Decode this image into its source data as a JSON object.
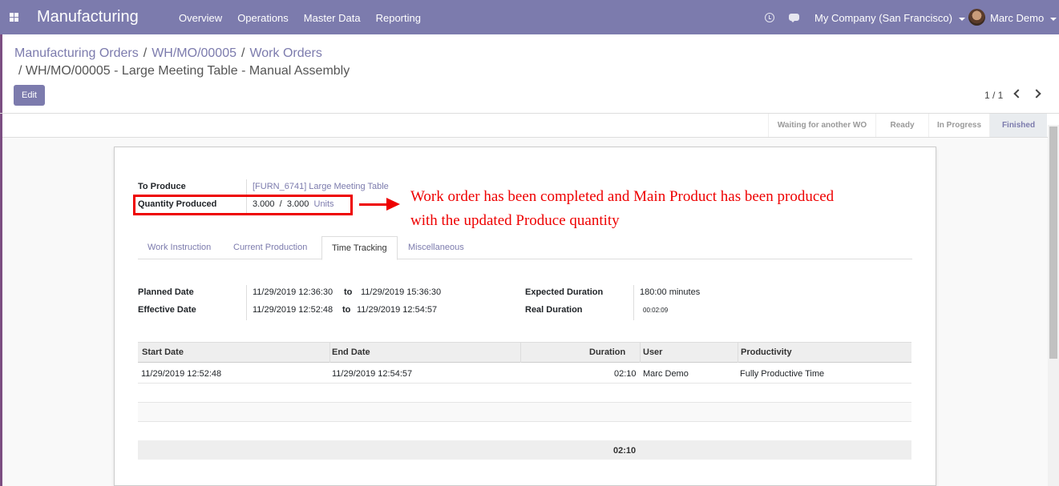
{
  "topbar": {
    "app_title": "Manufacturing",
    "menu": [
      "Overview",
      "Operations",
      "Master Data",
      "Reporting"
    ],
    "company": "My Company (San Francisco)",
    "user": "Marc Demo",
    "color": "#7c7bad"
  },
  "breadcrumb": {
    "items": [
      "Manufacturing Orders",
      "WH/MO/00005",
      "Work Orders"
    ],
    "separator": "/",
    "current": "/ WH/MO/00005 - Large Meeting Table - Manual Assembly"
  },
  "controls": {
    "edit_label": "Edit",
    "pager": "1 / 1"
  },
  "statusbar": {
    "stages": [
      "Waiting for another WO",
      "Ready",
      "In Progress",
      "Finished"
    ],
    "active": "Finished"
  },
  "form": {
    "to_produce_label": "To Produce",
    "to_produce_value": "[FURN_6741] Large Meeting Table",
    "qty_produced_label": "Quantity Produced",
    "qty_produced_value": "3.000",
    "qty_slash": "/",
    "qty_total": "3.000",
    "qty_unit": "Units"
  },
  "annotation": {
    "line1": "Work order has been completed and Main Product has been produced",
    "line2": "with the updated Produce quantity",
    "color": "#ee0000"
  },
  "tabs": [
    "Work Instruction",
    "Current Production",
    "Time Tracking",
    "Miscellaneous"
  ],
  "active_tab": "Time Tracking",
  "time_tracking": {
    "planned_date_label": "Planned Date",
    "planned_start": "11/29/2019 12:36:30",
    "to_label": "to",
    "planned_end": "11/29/2019 15:36:30",
    "effective_date_label": "Effective Date",
    "effective_start": "11/29/2019 12:52:48",
    "effective_end": "11/29/2019 12:54:57",
    "expected_duration_label": "Expected Duration",
    "expected_duration_value": "180:00 minutes",
    "real_duration_label": "Real Duration",
    "real_duration_value": "00:02:09"
  },
  "table": {
    "headers": [
      "Start Date",
      "End Date",
      "Duration",
      "User",
      "Productivity"
    ],
    "rows": [
      {
        "start": "11/29/2019 12:52:48",
        "end": "11/29/2019 12:54:57",
        "duration": "02:10",
        "user": "Marc Demo",
        "productivity": "Fully Productive Time"
      }
    ],
    "total_duration": "02:10"
  }
}
